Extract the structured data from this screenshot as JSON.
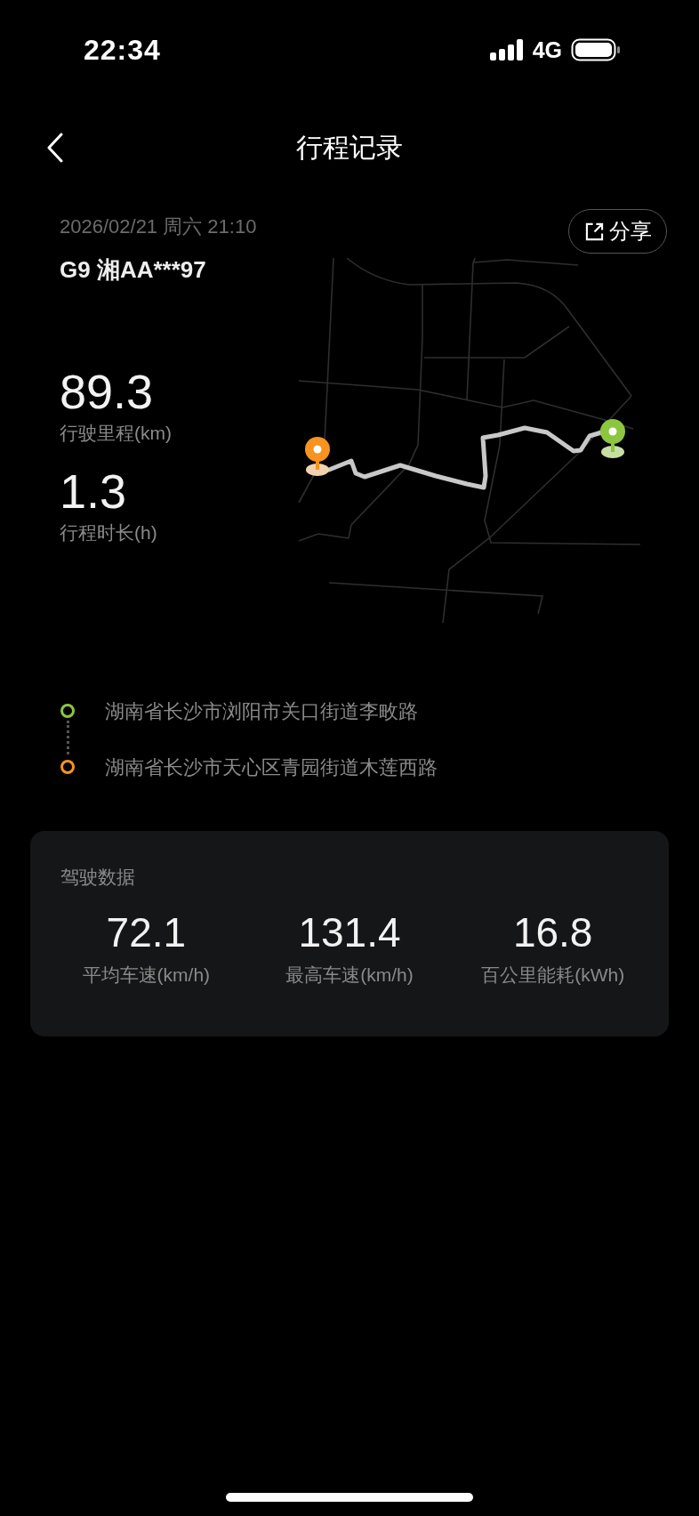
{
  "status_bar": {
    "time": "22:34",
    "network": "4G"
  },
  "nav": {
    "title": "行程记录"
  },
  "trip": {
    "datetime": "2026/02/21 周六 21:10",
    "vehicle": "G9 湘AA***97",
    "share_label": "分享",
    "stats": [
      {
        "value": "89.3",
        "label": "行驶里程(km)"
      },
      {
        "value": "1.3",
        "label": "行程时长(h)"
      }
    ]
  },
  "route": [
    {
      "address": "湖南省长沙市浏阳市关口街道李畋路",
      "color": "#8cc63f"
    },
    {
      "address": "湖南省长沙市天心区青园街道木莲西路",
      "color": "#f7931e"
    }
  ],
  "driving_data": {
    "title": "驾驶数据",
    "metrics": [
      {
        "value": "72.1",
        "label": "平均车速(km/h)"
      },
      {
        "value": "131.4",
        "label": "最高车速(km/h)"
      },
      {
        "value": "16.8",
        "label": "百公里能耗(kWh)"
      }
    ]
  }
}
